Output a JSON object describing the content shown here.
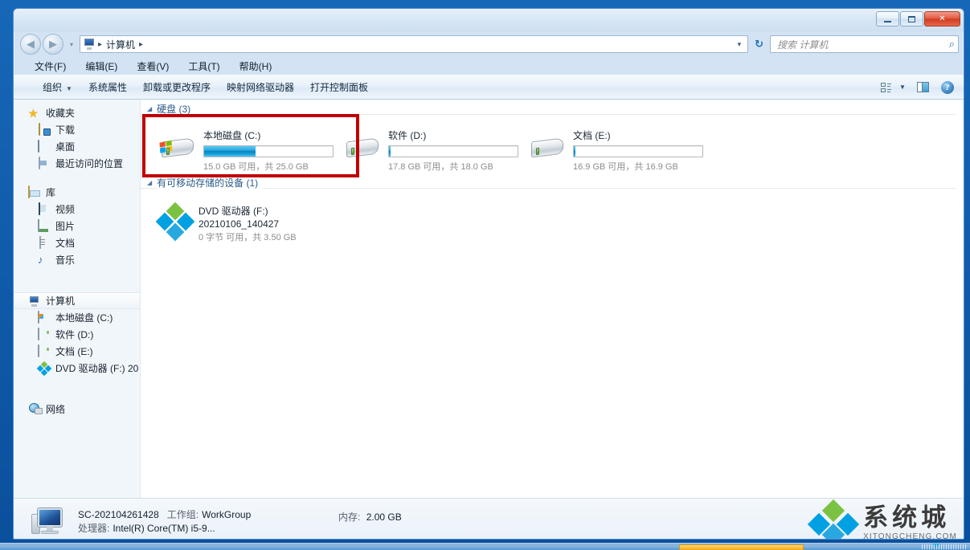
{
  "window": {
    "controls": {
      "minimize_label": "最小化",
      "maximize_label": "最大化",
      "close_label": "✕"
    }
  },
  "nav": {
    "back_glyph": "◀",
    "forward_glyph": "▶",
    "history_glyph": "▾",
    "address_icon": "computer-icon",
    "breadcrumbs": [
      "计算机"
    ],
    "sep": "▸",
    "dropdown_glyph": "▾",
    "refresh_glyph": "↻"
  },
  "search": {
    "placeholder": "搜索 计算机",
    "icon": "magnifier-icon",
    "icon_glyph": "⌕"
  },
  "menubar": {
    "items": [
      {
        "label": "文件(F)",
        "name": "menu-file"
      },
      {
        "label": "编辑(E)",
        "name": "menu-edit"
      },
      {
        "label": "查看(V)",
        "name": "menu-view"
      },
      {
        "label": "工具(T)",
        "name": "menu-tools"
      },
      {
        "label": "帮助(H)",
        "name": "menu-help"
      }
    ]
  },
  "toolbar": {
    "organize": "组织",
    "organize_caret": "▼",
    "items": [
      {
        "label": "系统属性",
        "name": "toolbar-system-properties"
      },
      {
        "label": "卸载或更改程序",
        "name": "toolbar-uninstall-change-program"
      },
      {
        "label": "映射网络驱动器",
        "name": "toolbar-map-network-drive"
      },
      {
        "label": "打开控制面板",
        "name": "toolbar-open-control-panel"
      }
    ],
    "views_caret": "▼",
    "help_glyph": "?"
  },
  "sidebar": {
    "groups": [
      {
        "header": {
          "label": "收藏夹",
          "icon": "star-icon",
          "name": "sidebar-group-favorites"
        },
        "items": [
          {
            "label": "下载",
            "icon": "download-icon",
            "name": "sidebar-item-downloads"
          },
          {
            "label": "桌面",
            "icon": "desktop-icon",
            "name": "sidebar-item-desktop"
          },
          {
            "label": "最近访问的位置",
            "icon": "recent-places-icon",
            "name": "sidebar-item-recent-places"
          }
        ]
      },
      {
        "header": {
          "label": "库",
          "icon": "library-icon",
          "name": "sidebar-group-libraries"
        },
        "items": [
          {
            "label": "视频",
            "icon": "video-icon",
            "name": "sidebar-item-videos"
          },
          {
            "label": "图片",
            "icon": "picture-icon",
            "name": "sidebar-item-pictures"
          },
          {
            "label": "文档",
            "icon": "document-icon",
            "name": "sidebar-item-documents"
          },
          {
            "label": "音乐",
            "icon": "music-icon",
            "name": "sidebar-item-music"
          }
        ]
      },
      {
        "header": {
          "label": "计算机",
          "icon": "computer-icon",
          "name": "sidebar-group-computer",
          "selected": true
        },
        "items": [
          {
            "label": "本地磁盘 (C:)",
            "icon": "hdd-windows-icon",
            "name": "sidebar-item-local-disk-c"
          },
          {
            "label": "软件 (D:)",
            "icon": "hdd-icon",
            "name": "sidebar-item-software-d"
          },
          {
            "label": "文档 (E:)",
            "icon": "hdd-icon",
            "name": "sidebar-item-documents-e"
          },
          {
            "label": "DVD 驱动器 (F:) 20",
            "icon": "dvd-icon",
            "name": "sidebar-item-dvd-drive-f"
          }
        ]
      },
      {
        "header": {
          "label": "网络",
          "icon": "network-icon",
          "name": "sidebar-group-network"
        },
        "items": []
      }
    ]
  },
  "content": {
    "groups": [
      {
        "name": "group-hard-disks",
        "title": "硬盘 (3)",
        "collapse_glyph": "◢",
        "drives": [
          {
            "name": "drive-tile-c",
            "label": "本地磁盘 (C:)",
            "icon": "hdd-windows-icon",
            "sub": "15.0 GB 可用，共 25.0 GB",
            "free_text": "15.0 GB",
            "total_text": "25.0 GB",
            "used_percent": 40,
            "highlighted": true
          },
          {
            "name": "drive-tile-d",
            "label": "软件 (D:)",
            "icon": "hdd-icon",
            "sub": "17.8 GB 可用，共 18.0 GB",
            "free_text": "17.8 GB",
            "total_text": "18.0 GB",
            "used_percent": 1,
            "highlighted": false
          },
          {
            "name": "drive-tile-e",
            "label": "文档 (E:)",
            "icon": "hdd-icon",
            "sub": "16.9 GB 可用，共 16.9 GB",
            "free_text": "16.9 GB",
            "total_text": "16.9 GB",
            "used_percent": 1,
            "highlighted": false
          }
        ]
      },
      {
        "name": "group-removable-storage",
        "title": "有可移动存储的设备 (1)",
        "collapse_glyph": "◢",
        "devices": [
          {
            "name": "drive-tile-f",
            "label": "DVD 驱动器 (F:)",
            "icon": "dvd-icon",
            "volume": "20210106_140427",
            "sub": "0 字节 可用，共 3.50 GB"
          }
        ]
      }
    ]
  },
  "details": {
    "computer_icon": "computer-icon",
    "hostname": "SC-202104261428",
    "workgroup_key": "工作组:",
    "workgroup_value": "WorkGroup",
    "processor_key": "处理器:",
    "processor_value": "Intel(R) Core(TM) i5-9...",
    "memory_key": "内存:",
    "memory_value": "2.00 GB"
  },
  "watermark": {
    "cn": "系统城",
    "en": "XITONGCHENG.COM",
    "logo": "diamond-logo-icon"
  },
  "colors": {
    "accent": "#0a86c4",
    "highlight_box": "#c00000",
    "desktop": "#0f5aa8",
    "logo_green": "#7cc242",
    "logo_blue": "#00a0e3"
  }
}
